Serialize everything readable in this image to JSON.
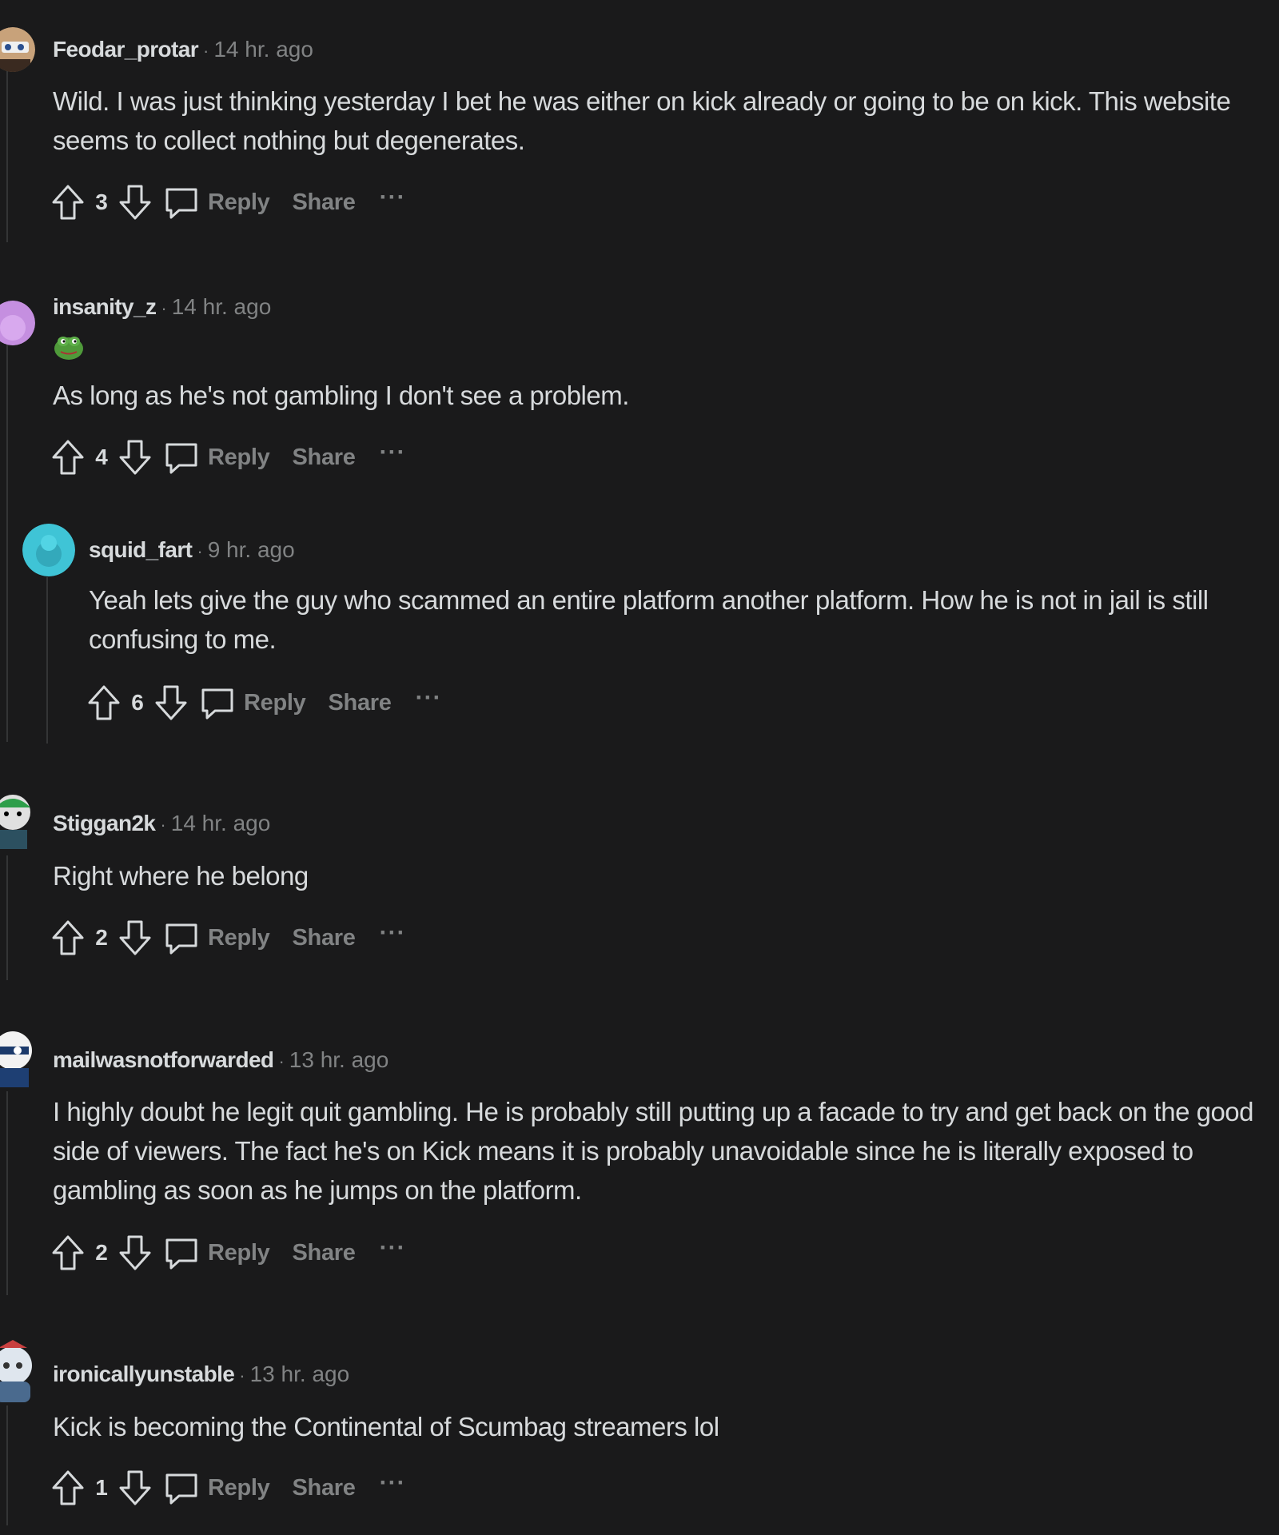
{
  "comments": [
    {
      "username": "Feodar_protar",
      "time": "14 hr. ago",
      "body": "Wild. I was just thinking yesterday I bet he was either on kick already or going to be on kick. This website seems to collect nothing but degenerates.",
      "score": "3",
      "reply_label": "Reply",
      "share_label": "Share",
      "more_label": "···",
      "avatar_color": "#c8a27a"
    },
    {
      "username": "insanity_z",
      "time": "14 hr. ago",
      "flair_icon": "pepe-frog-icon",
      "body": "As long as he's not gambling I don't see a problem.",
      "score": "4",
      "reply_label": "Reply",
      "share_label": "Share",
      "more_label": "···",
      "avatar_color": "#c58fe0"
    },
    {
      "username": "squid_fart",
      "time": "9 hr. ago",
      "body": "Yeah lets give the guy who scammed an entire platform another platform. How he is not in jail is still confusing to me.",
      "score": "6",
      "reply_label": "Reply",
      "share_label": "Share",
      "more_label": "···",
      "avatar_color": "#3fc4d6"
    },
    {
      "username": "Stiggan2k",
      "time": "14 hr. ago",
      "body": "Right where he belong",
      "score": "2",
      "reply_label": "Reply",
      "share_label": "Share",
      "more_label": "···",
      "avatar_color": "#3aa55c"
    },
    {
      "username": "mailwasnotforwarded",
      "time": "13 hr. ago",
      "body": "I highly doubt he legit quit gambling. He is probably still putting up a facade to try and get back on the good side of viewers. The fact he's on Kick means it is probably unavoidable since he is literally exposed to gambling as soon as he jumps on the platform.",
      "score": "2",
      "reply_label": "Reply",
      "share_label": "Share",
      "more_label": "···",
      "avatar_color": "#2b5fa8"
    },
    {
      "username": "ironicallyunstable",
      "time": "13 hr. ago",
      "body": "Kick is becoming the Continental of Scumbag streamers lol",
      "score": "1",
      "reply_label": "Reply",
      "share_label": "Share",
      "more_label": "···",
      "avatar_color": "#6a8aa8"
    }
  ]
}
